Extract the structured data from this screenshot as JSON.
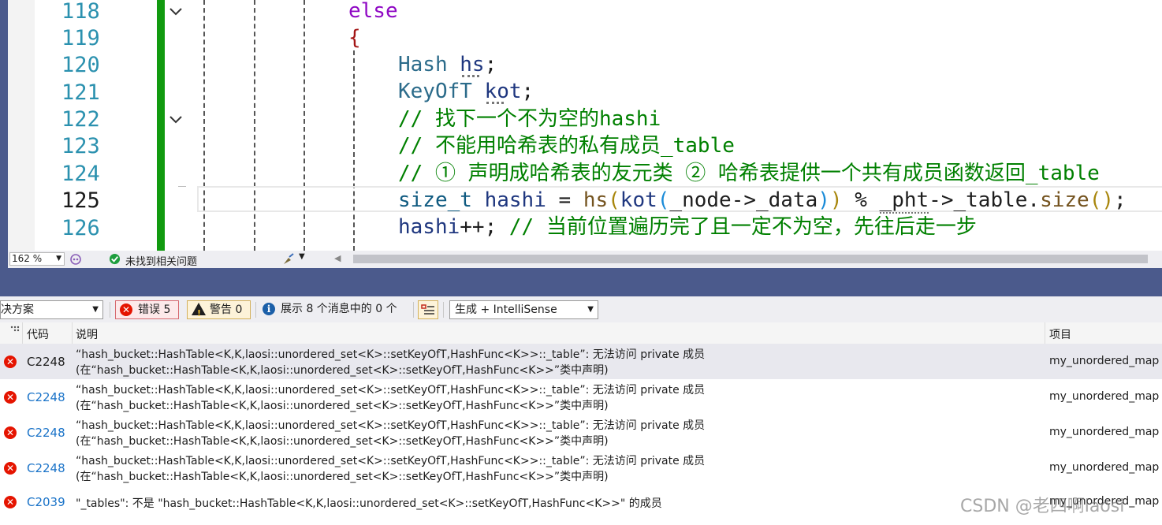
{
  "editor": {
    "line_numbers": [
      "118",
      "119",
      "120",
      "121",
      "122",
      "123",
      "124",
      "125",
      "126"
    ],
    "current_line": "125",
    "lines": {
      "l118": {
        "kw": "else"
      },
      "l119": {
        "brace": "{"
      },
      "l120": {
        "type": "Hash",
        "var": "hs",
        "semi": ";"
      },
      "l121": {
        "type": "KeyOfT",
        "var": "kot",
        "semi": ";"
      },
      "l122": {
        "comment": "// 找下一个不为空的hashi"
      },
      "l123": {
        "comment": "// 不能用哈希表的私有成员_table"
      },
      "l124": {
        "comment": "// ① 声明成哈希表的友元类 ② 哈希表提供一个共有成员函数返回_table"
      },
      "l125": {
        "type": "size_t",
        "var": "hashi",
        "eq": " = ",
        "fn1": "hs",
        "p1o": "(",
        "fn2": "kot",
        "p2o": "(",
        "arg": "_node->_data",
        "p2c": ")",
        "p1c": ")",
        "op": " % ",
        "pht": "_pht",
        "arrow": "->_table.",
        "fn3": "size",
        "p3": "()",
        "semi": ";"
      },
      "l126": {
        "var": "hashi",
        "op": "++; ",
        "comment": "// 当前位置遍历完了且一定不为空，先往后走一步"
      }
    }
  },
  "status_bar": {
    "zoom": "162 %",
    "issues_text": "未找到相关问题"
  },
  "error_list": {
    "scope_label": "决方案",
    "errors_label": "错误 5",
    "warnings_label": "警告 0",
    "messages_label": "展示 8 个消息中的 0 个",
    "build_filter": "生成 + IntelliSense",
    "columns": {
      "code": "代码",
      "description": "说明",
      "project": "项目"
    },
    "rows": [
      {
        "code": "C2248",
        "line1": "“hash_bucket::HashTable<K,K,laosi::unordered_set<K>::setKeyOfT,HashFunc<K>>::_table”: 无法访问 private 成员",
        "line2": "(在“hash_bucket::HashTable<K,K,laosi::unordered_set<K>::setKeyOfT,HashFunc<K>>”类中声明)",
        "project": "my_unordered_map"
      },
      {
        "code": "C2248",
        "line1": "“hash_bucket::HashTable<K,K,laosi::unordered_set<K>::setKeyOfT,HashFunc<K>>::_table”: 无法访问 private 成员",
        "line2": "(在“hash_bucket::HashTable<K,K,laosi::unordered_set<K>::setKeyOfT,HashFunc<K>>”类中声明)",
        "project": "my_unordered_map"
      },
      {
        "code": "C2248",
        "line1": "“hash_bucket::HashTable<K,K,laosi::unordered_set<K>::setKeyOfT,HashFunc<K>>::_table”: 无法访问 private 成员",
        "line2": "(在“hash_bucket::HashTable<K,K,laosi::unordered_set<K>::setKeyOfT,HashFunc<K>>”类中声明)",
        "project": "my_unordered_map"
      },
      {
        "code": "C2248",
        "line1": "“hash_bucket::HashTable<K,K,laosi::unordered_set<K>::setKeyOfT,HashFunc<K>>::_table”: 无法访问 private 成员",
        "line2": "(在“hash_bucket::HashTable<K,K,laosi::unordered_set<K>::setKeyOfT,HashFunc<K>>”类中声明)",
        "project": "my_unordered_map"
      },
      {
        "code": "C2039",
        "line1": "\"_tables\": 不是 \"hash_bucket::HashTable<K,K,laosi::unordered_set<K>::setKeyOfT,HashFunc<K>>\" 的成员",
        "project": "my_unordered_map"
      }
    ]
  },
  "watermark": "CSDN @老四啊laosi",
  "colors": {
    "accent_green": "#119a0f",
    "error_red": "#e51400",
    "link_blue": "#1a73c8"
  }
}
